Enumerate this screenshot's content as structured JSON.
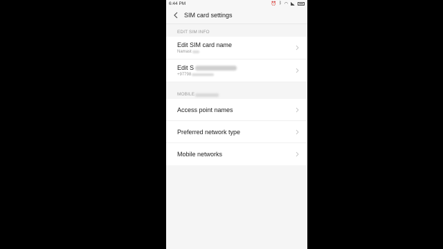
{
  "status_bar": {
    "time": "6:44 PM"
  },
  "header": {
    "title": "SIM card settings"
  },
  "sections": {
    "edit_sim_info": {
      "header": "EDIT SIM INFO",
      "items": [
        {
          "label": "Edit SIM card name",
          "value": "Namast"
        },
        {
          "label": "Edit S",
          "value": "+97798"
        }
      ]
    },
    "mobile": {
      "header": "MOBILE",
      "items": [
        {
          "label": "Access point names"
        },
        {
          "label": "Preferred network type"
        },
        {
          "label": "Mobile networks"
        }
      ]
    }
  }
}
